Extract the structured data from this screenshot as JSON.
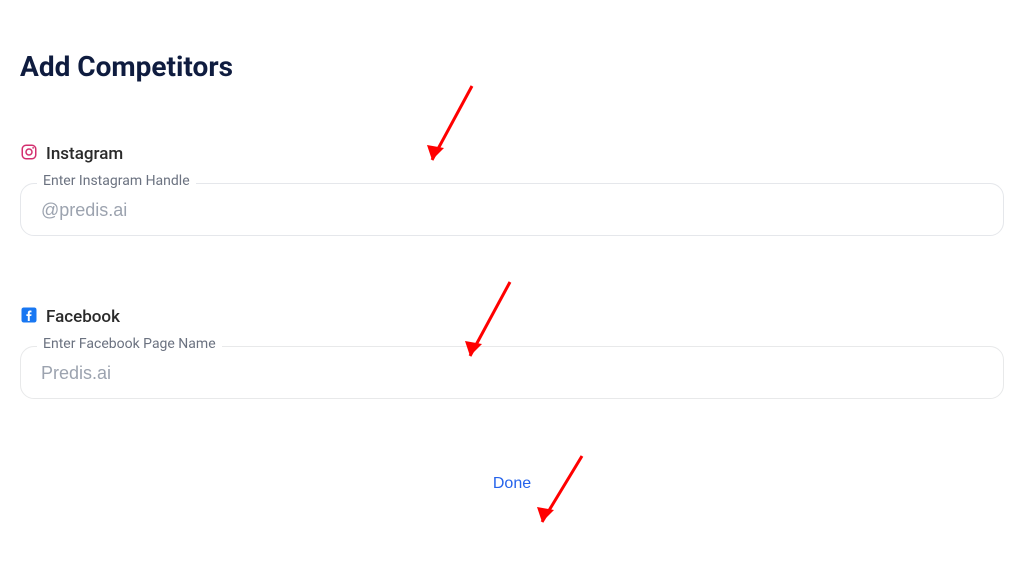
{
  "title": "Add Competitors",
  "instagram": {
    "section_label": "Instagram",
    "field_legend": "Enter Instagram Handle",
    "placeholder": "@predis.ai"
  },
  "facebook": {
    "section_label": "Facebook",
    "field_legend": "Enter Facebook Page Name",
    "placeholder": "Predis.ai"
  },
  "actions": {
    "done_label": "Done"
  },
  "annotations": {
    "arrow_color": "#ff0000"
  }
}
